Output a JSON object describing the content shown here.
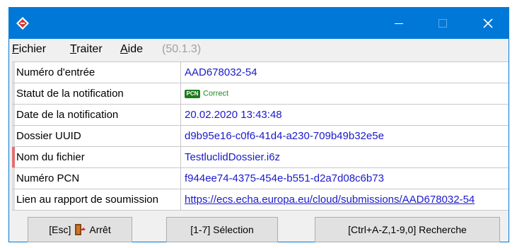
{
  "window": {
    "app_icon": "diamond-app-icon",
    "controls": {
      "minimize_icon": "minimize-icon",
      "maximize_icon": "maximize-icon",
      "close_icon": "close-icon"
    }
  },
  "menu": {
    "items": [
      {
        "first": "F",
        "rest": "ichier"
      },
      {
        "first": "T",
        "rest": "raiter"
      },
      {
        "first": "A",
        "rest": "ide"
      }
    ],
    "version": "(50.1.3)"
  },
  "rows": [
    {
      "label": "Numéro d'entrée",
      "value": "AAD678032-54"
    },
    {
      "label": "Statut de la notification",
      "value": "Correct",
      "badge": "PCN"
    },
    {
      "label": "Date de la notification",
      "value": "20.02.2020 13:43:48"
    },
    {
      "label": "Dossier UUID",
      "value": "d9b95e16-c0f6-41d4-a230-709b49b32e5e"
    },
    {
      "label": "Nom du fichier",
      "value": "TestluclidDossier.i6z"
    },
    {
      "label": "Numéro PCN",
      "value": "f944ee74-4375-454e-b551-d2a7d08c6b73"
    },
    {
      "label": "Lien au rapport de soumission",
      "value": "https://ecs.echa.europa.eu/cloud/submissions/AAD678032-54"
    }
  ],
  "buttons": {
    "stop_prefix": "[Esc]",
    "stop_label": "Arrêt",
    "stop_icon": "exit-door-icon",
    "select_label": "[1-7] Sélection",
    "search_label": "[Ctrl+A-Z,1-9,0] Recherche"
  },
  "colors": {
    "titlebar": "#0078d7",
    "value_text": "#1a1acc",
    "correct": "#1f8a1f",
    "active_marker": "#e07070"
  }
}
